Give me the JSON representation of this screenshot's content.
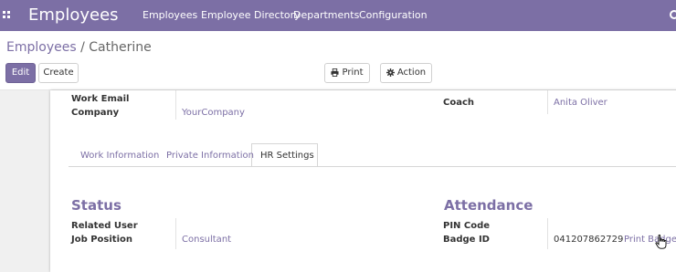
{
  "topbar": {
    "app_title": "Employees",
    "menu": [
      "Employees",
      "Employee Directory",
      "Departments",
      "Configuration"
    ]
  },
  "breadcrumb": {
    "parent": "Employees",
    "separator": "/",
    "current": "Catherine"
  },
  "toolbar": {
    "edit_label": "Edit",
    "create_label": "Create",
    "print_label": "Print",
    "action_label": "Action"
  },
  "form": {
    "left_fields": [
      {
        "label": "Work Email",
        "value": ""
      },
      {
        "label": "Company",
        "value": "YourCompany"
      }
    ],
    "right_fields": [
      {
        "label": "Coach",
        "value": "Anita Oliver"
      }
    ]
  },
  "tabs": [
    "Work Information",
    "Private Information",
    "HR Settings"
  ],
  "active_tab": "HR Settings",
  "status": {
    "title": "Status",
    "fields": [
      {
        "label": "Related User",
        "value": ""
      },
      {
        "label": "Job Position",
        "value": "Consultant"
      }
    ]
  },
  "attendance": {
    "title": "Attendance",
    "fields": [
      {
        "label": "PIN Code",
        "value": ""
      },
      {
        "label": "Badge ID",
        "value": "041207862729"
      }
    ],
    "print_badge_label": "Print Badge"
  },
  "colors": {
    "brand": "#7c6fa5",
    "topbar": "#7c6fa5",
    "link": "#7c6fa5"
  }
}
